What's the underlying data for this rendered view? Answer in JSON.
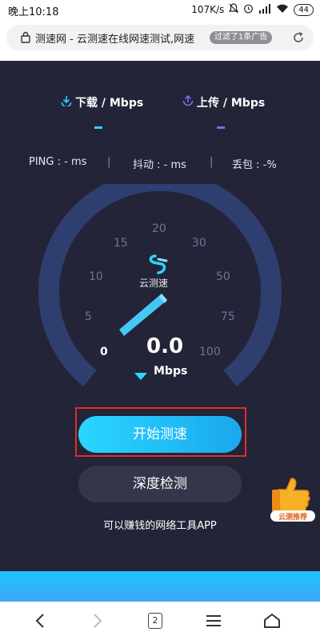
{
  "status_bar": {
    "time": "晚上10:18",
    "net_speed": "107K/s",
    "battery": "44"
  },
  "url_bar": {
    "title": "测速网 - 云测速在线网速测试,网速",
    "ad_filter": "过滤了1条广告"
  },
  "speed_test": {
    "download_label": "下载 / Mbps",
    "upload_label": "上传 / Mbps",
    "download_value": "-",
    "upload_value": "-",
    "ping": "PING : - ms",
    "jitter": "抖动 : - ms",
    "packet_loss": "丢包 : -%",
    "separator": "|",
    "gauge_scale": [
      "0",
      "5",
      "10",
      "15",
      "20",
      "30",
      "50",
      "75",
      "100"
    ],
    "current_speed": "0.0",
    "unit": "Mbps",
    "logo_text": "云测速"
  },
  "actions": {
    "start": "开始测速",
    "deep": "深度检测",
    "earn_text": "可以赚钱的网络工具APP",
    "promo_badge": "云测推荐"
  },
  "nav": {
    "tab_count": "2"
  },
  "colors": {
    "panel_bg": "#232437",
    "accent_cyan": "#2ad6ff",
    "accent_purple": "#7b6cf2",
    "highlight_frame": "#e02d2d"
  }
}
